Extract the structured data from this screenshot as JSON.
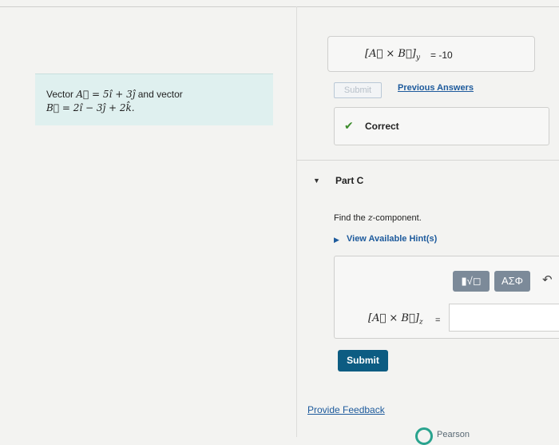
{
  "problem": {
    "line1_prefix": "Vector ",
    "vector_a": "A⃗ = 5î + 3ĵ",
    "line1_suffix": " and vector",
    "vector_b": "B⃗ = 2î − 3ĵ + 2k̂."
  },
  "part_b": {
    "expression": "[A⃗ × B⃗]",
    "subscript": "y",
    "answer": "= -10",
    "submit_label": "Submit",
    "previous_answers_label": "Previous Answers",
    "status_label": "Correct"
  },
  "part_c": {
    "title": "Part C",
    "question_prefix": "Find the ",
    "question_var": "z",
    "question_suffix": "-component.",
    "hint_label": "View Available Hint(s)",
    "expression": "[A⃗ × B⃗]",
    "subscript": "z",
    "equals": "=",
    "answer_value": "",
    "toolbar": {
      "templates_label": "▮√◻",
      "greek_label": "ΑΣΦ"
    },
    "submit_label": "Submit"
  },
  "footer": {
    "feedback_label": "Provide Feedback",
    "logo_text": "Pearson"
  },
  "colors": {
    "problem_bg": "#dff0ef",
    "link": "#1d5a9c",
    "submit_bg": "#0d5c82",
    "correct_check": "#3d8c2c",
    "tool_btn": "#7c8a99"
  }
}
